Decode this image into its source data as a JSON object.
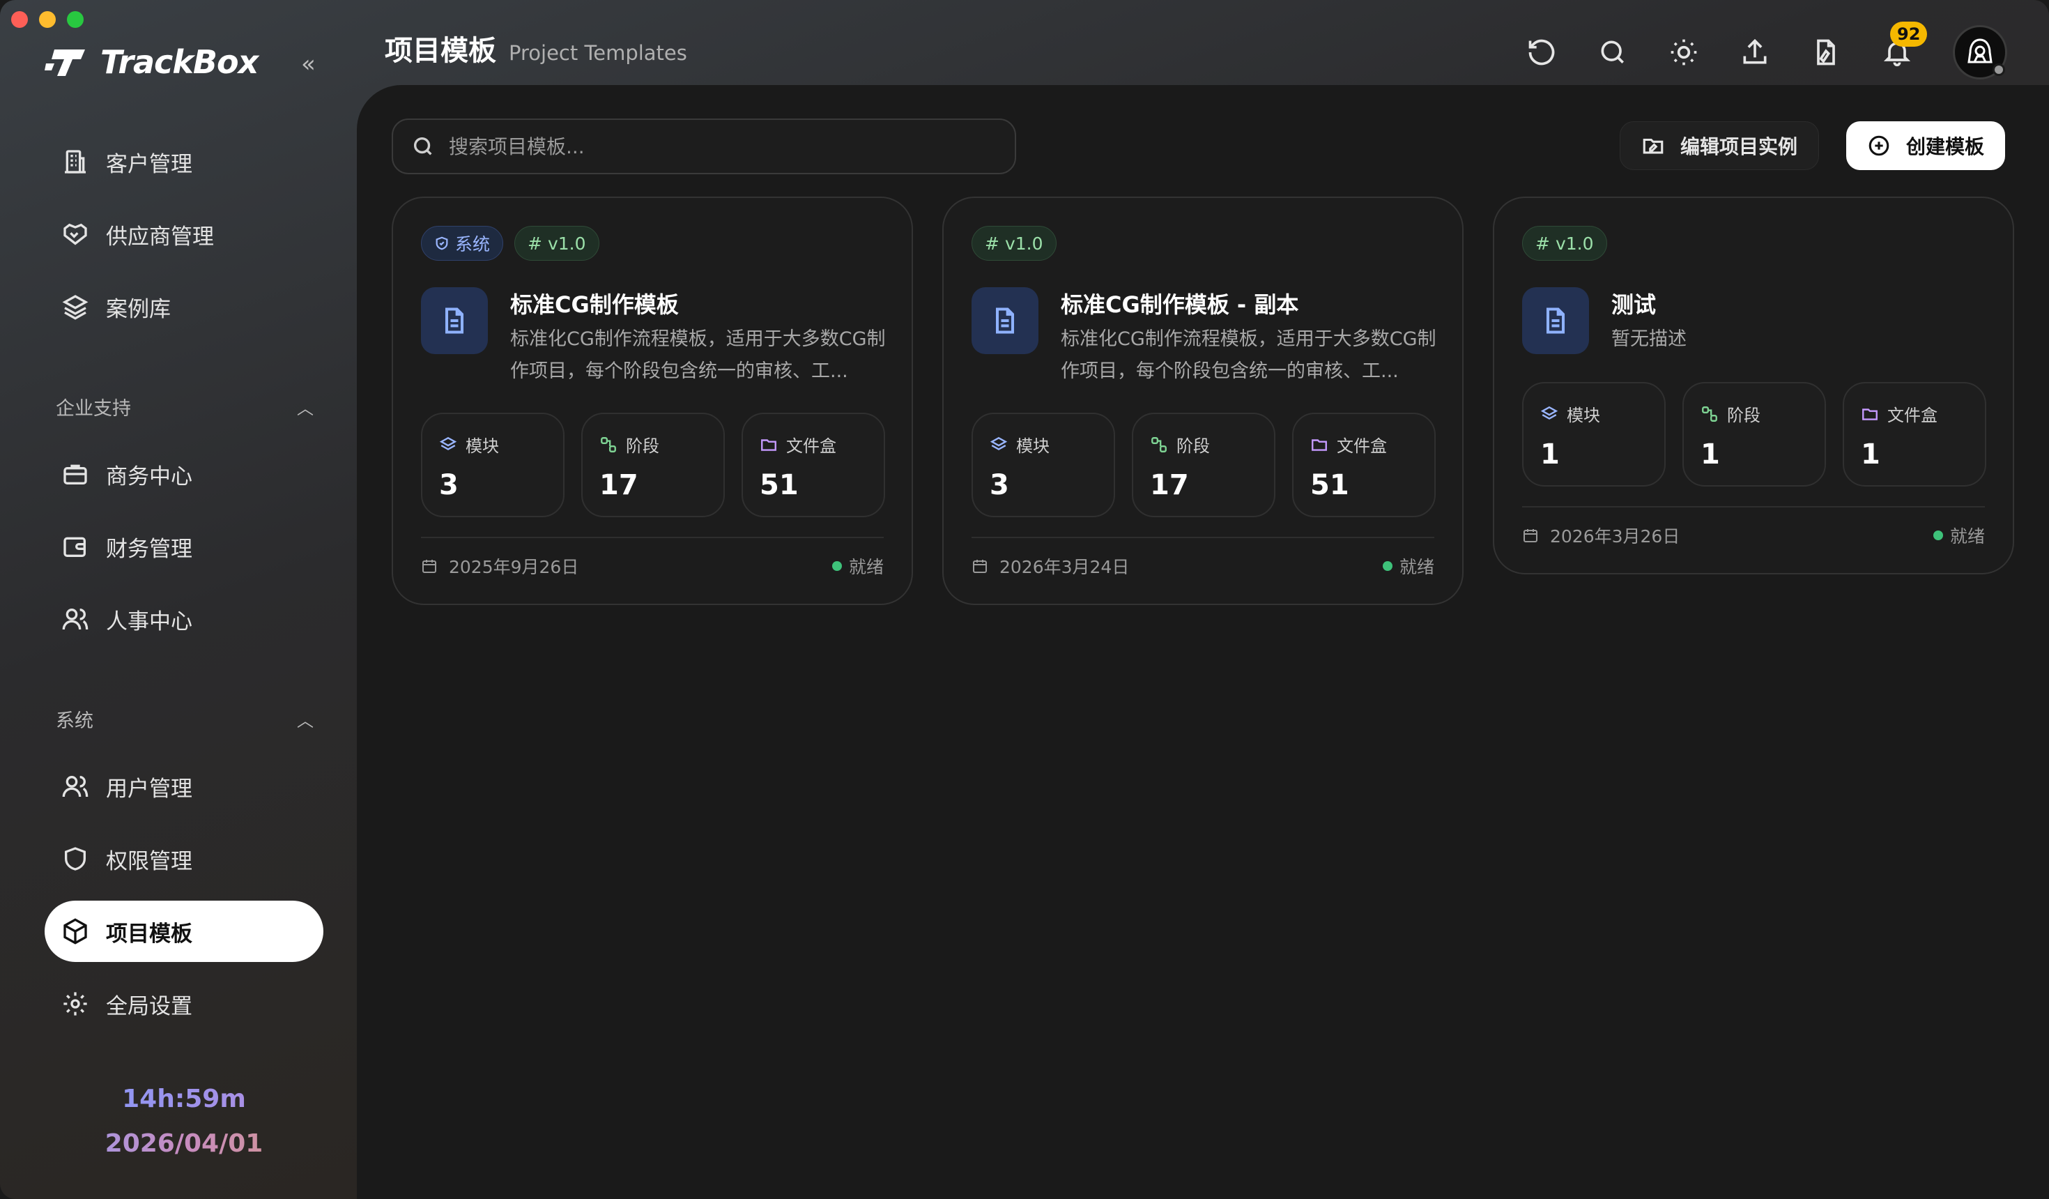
{
  "app": {
    "name": "TrackBox"
  },
  "page": {
    "title_zh": "项目模板",
    "title_en": "Project Templates"
  },
  "sidebar": {
    "collapse_label": "«",
    "top_items": [
      {
        "label": "客户管理"
      },
      {
        "label": "供应商管理"
      },
      {
        "label": "案例库"
      }
    ],
    "sections": [
      {
        "title": "企业支持",
        "items": [
          {
            "label": "商务中心"
          },
          {
            "label": "财务管理"
          },
          {
            "label": "人事中心"
          }
        ]
      },
      {
        "title": "系统",
        "items": [
          {
            "label": "用户管理"
          },
          {
            "label": "权限管理"
          },
          {
            "label": "项目模板"
          },
          {
            "label": "全局设置"
          }
        ]
      }
    ],
    "active_item": "项目模板",
    "timer": "14h:59m",
    "date": "2026/04/01"
  },
  "header": {
    "icons": [
      "refresh-icon",
      "search-icon",
      "theme-sun-icon",
      "upload-icon",
      "file-sign-icon",
      "bell-icon"
    ],
    "notification_count": "92"
  },
  "toolbar": {
    "search_placeholder": "搜索项目模板...",
    "edit_button": "编辑项目实例",
    "create_button": "创建模板"
  },
  "cards": [
    {
      "system_tag": "系统",
      "version": "v1.0",
      "title": "标准CG制作模板",
      "description": "标准化CG制作流程模板，适用于大多数CG制作项目，每个阶段包含统一的审核、工...",
      "stats": [
        {
          "label": "模块",
          "value": "3"
        },
        {
          "label": "阶段",
          "value": "17"
        },
        {
          "label": "文件盒",
          "value": "51"
        }
      ],
      "date": "2025年9月26日",
      "status": "就绪"
    },
    {
      "version": "v1.0",
      "title": "标准CG制作模板 - 副本",
      "description": "标准化CG制作流程模板，适用于大多数CG制作项目，每个阶段包含统一的审核、工...",
      "stats": [
        {
          "label": "模块",
          "value": "3"
        },
        {
          "label": "阶段",
          "value": "17"
        },
        {
          "label": "文件盒",
          "value": "51"
        }
      ],
      "date": "2026年3月24日",
      "status": "就绪"
    },
    {
      "version": "v1.0",
      "title": "测试",
      "description": "暂无描述",
      "stats": [
        {
          "label": "模块",
          "value": "1"
        },
        {
          "label": "阶段",
          "value": "1"
        },
        {
          "label": "文件盒",
          "value": "1"
        }
      ],
      "date": "2026年3月26日",
      "status": "就绪"
    }
  ],
  "colors": {
    "accent": "#ffffff",
    "tag_system": "#9ab6ff",
    "tag_version": "#9be0a9",
    "status_ready": "#3ec27a",
    "badge": "#f5b800"
  }
}
